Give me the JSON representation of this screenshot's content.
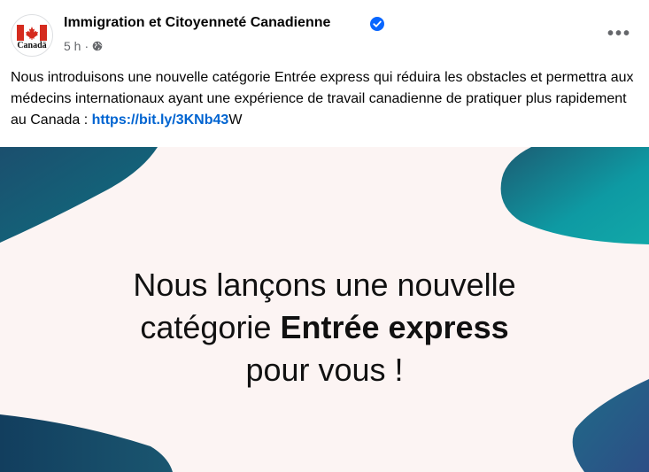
{
  "page": {
    "name": "Immigration et Citoyenneté Canadienne",
    "avatar_wordmark": "Canadä",
    "time": "5 h",
    "separator": "·"
  },
  "post": {
    "text_before_link": "Nous introduisons une nouvelle catégorie Entrée express qui réduira les obstacles et permettra aux médecins internationaux ayant une expérience de travail canadienne de pratiquer plus rapidement au Canada : ",
    "link_text": "https://bit.ly/3KNb43",
    "text_after_link": "W"
  },
  "image": {
    "line1": "Nous lançons une nouvelle",
    "line2_plain": "catégorie ",
    "line2_bold": "Entrée express",
    "line3": "pour vous !"
  },
  "icons": {
    "verified": "verified-badge-icon",
    "audience": "globe-icon",
    "more": "more-options-icon"
  },
  "colors": {
    "link": "#0064d1",
    "verified": "#0866ff",
    "flag_red": "#d52b1e",
    "teal": "#0e9aa3",
    "navy": "#24506e"
  }
}
